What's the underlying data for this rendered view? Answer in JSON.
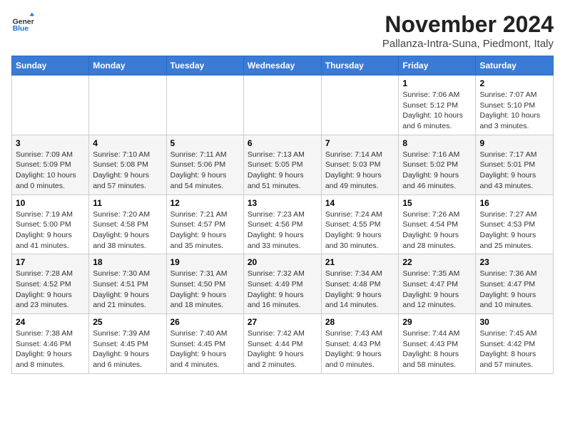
{
  "logo": {
    "general": "General",
    "blue": "Blue"
  },
  "header": {
    "month": "November 2024",
    "location": "Pallanza-Intra-Suna, Piedmont, Italy"
  },
  "weekdays": [
    "Sunday",
    "Monday",
    "Tuesday",
    "Wednesday",
    "Thursday",
    "Friday",
    "Saturday"
  ],
  "weeks": [
    [
      {
        "day": "",
        "info": ""
      },
      {
        "day": "",
        "info": ""
      },
      {
        "day": "",
        "info": ""
      },
      {
        "day": "",
        "info": ""
      },
      {
        "day": "",
        "info": ""
      },
      {
        "day": "1",
        "info": "Sunrise: 7:06 AM\nSunset: 5:12 PM\nDaylight: 10 hours\nand 6 minutes."
      },
      {
        "day": "2",
        "info": "Sunrise: 7:07 AM\nSunset: 5:10 PM\nDaylight: 10 hours\nand 3 minutes."
      }
    ],
    [
      {
        "day": "3",
        "info": "Sunrise: 7:09 AM\nSunset: 5:09 PM\nDaylight: 10 hours\nand 0 minutes."
      },
      {
        "day": "4",
        "info": "Sunrise: 7:10 AM\nSunset: 5:08 PM\nDaylight: 9 hours\nand 57 minutes."
      },
      {
        "day": "5",
        "info": "Sunrise: 7:11 AM\nSunset: 5:06 PM\nDaylight: 9 hours\nand 54 minutes."
      },
      {
        "day": "6",
        "info": "Sunrise: 7:13 AM\nSunset: 5:05 PM\nDaylight: 9 hours\nand 51 minutes."
      },
      {
        "day": "7",
        "info": "Sunrise: 7:14 AM\nSunset: 5:03 PM\nDaylight: 9 hours\nand 49 minutes."
      },
      {
        "day": "8",
        "info": "Sunrise: 7:16 AM\nSunset: 5:02 PM\nDaylight: 9 hours\nand 46 minutes."
      },
      {
        "day": "9",
        "info": "Sunrise: 7:17 AM\nSunset: 5:01 PM\nDaylight: 9 hours\nand 43 minutes."
      }
    ],
    [
      {
        "day": "10",
        "info": "Sunrise: 7:19 AM\nSunset: 5:00 PM\nDaylight: 9 hours\nand 41 minutes."
      },
      {
        "day": "11",
        "info": "Sunrise: 7:20 AM\nSunset: 4:58 PM\nDaylight: 9 hours\nand 38 minutes."
      },
      {
        "day": "12",
        "info": "Sunrise: 7:21 AM\nSunset: 4:57 PM\nDaylight: 9 hours\nand 35 minutes."
      },
      {
        "day": "13",
        "info": "Sunrise: 7:23 AM\nSunset: 4:56 PM\nDaylight: 9 hours\nand 33 minutes."
      },
      {
        "day": "14",
        "info": "Sunrise: 7:24 AM\nSunset: 4:55 PM\nDaylight: 9 hours\nand 30 minutes."
      },
      {
        "day": "15",
        "info": "Sunrise: 7:26 AM\nSunset: 4:54 PM\nDaylight: 9 hours\nand 28 minutes."
      },
      {
        "day": "16",
        "info": "Sunrise: 7:27 AM\nSunset: 4:53 PM\nDaylight: 9 hours\nand 25 minutes."
      }
    ],
    [
      {
        "day": "17",
        "info": "Sunrise: 7:28 AM\nSunset: 4:52 PM\nDaylight: 9 hours\nand 23 minutes."
      },
      {
        "day": "18",
        "info": "Sunrise: 7:30 AM\nSunset: 4:51 PM\nDaylight: 9 hours\nand 21 minutes."
      },
      {
        "day": "19",
        "info": "Sunrise: 7:31 AM\nSunset: 4:50 PM\nDaylight: 9 hours\nand 18 minutes."
      },
      {
        "day": "20",
        "info": "Sunrise: 7:32 AM\nSunset: 4:49 PM\nDaylight: 9 hours\nand 16 minutes."
      },
      {
        "day": "21",
        "info": "Sunrise: 7:34 AM\nSunset: 4:48 PM\nDaylight: 9 hours\nand 14 minutes."
      },
      {
        "day": "22",
        "info": "Sunrise: 7:35 AM\nSunset: 4:47 PM\nDaylight: 9 hours\nand 12 minutes."
      },
      {
        "day": "23",
        "info": "Sunrise: 7:36 AM\nSunset: 4:47 PM\nDaylight: 9 hours\nand 10 minutes."
      }
    ],
    [
      {
        "day": "24",
        "info": "Sunrise: 7:38 AM\nSunset: 4:46 PM\nDaylight: 9 hours\nand 8 minutes."
      },
      {
        "day": "25",
        "info": "Sunrise: 7:39 AM\nSunset: 4:45 PM\nDaylight: 9 hours\nand 6 minutes."
      },
      {
        "day": "26",
        "info": "Sunrise: 7:40 AM\nSunset: 4:45 PM\nDaylight: 9 hours\nand 4 minutes."
      },
      {
        "day": "27",
        "info": "Sunrise: 7:42 AM\nSunset: 4:44 PM\nDaylight: 9 hours\nand 2 minutes."
      },
      {
        "day": "28",
        "info": "Sunrise: 7:43 AM\nSunset: 4:43 PM\nDaylight: 9 hours\nand 0 minutes."
      },
      {
        "day": "29",
        "info": "Sunrise: 7:44 AM\nSunset: 4:43 PM\nDaylight: 8 hours\nand 58 minutes."
      },
      {
        "day": "30",
        "info": "Sunrise: 7:45 AM\nSunset: 4:42 PM\nDaylight: 8 hours\nand 57 minutes."
      }
    ]
  ]
}
